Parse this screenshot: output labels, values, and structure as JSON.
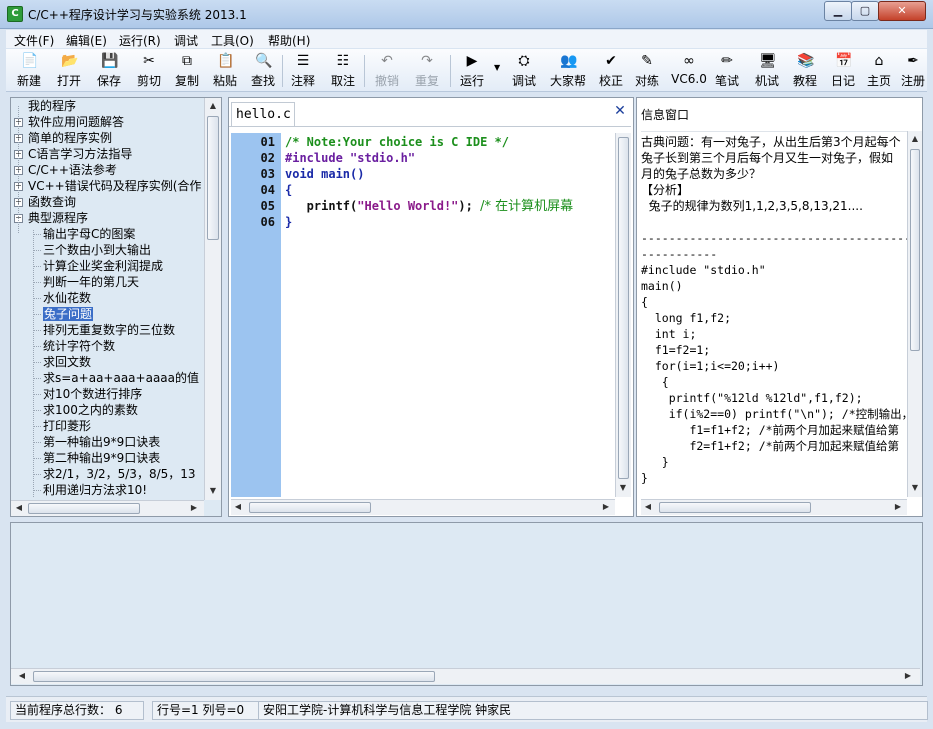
{
  "window": {
    "title": "C/C++程序设计学习与实验系统 2013.1",
    "icon_label": "C"
  },
  "menu": [
    "文件(F)",
    "编辑(E)",
    "运行(R)",
    "调试",
    "工具(O)",
    "帮助(H)"
  ],
  "toolbar": [
    {
      "label": "新建",
      "icon": "new-file-icon",
      "glyph": "📄"
    },
    {
      "label": "打开",
      "icon": "open-folder-icon",
      "glyph": "📂"
    },
    {
      "label": "保存",
      "icon": "save-icon",
      "glyph": "💾"
    },
    {
      "label": "剪切",
      "icon": "cut-icon",
      "glyph": "✂"
    },
    {
      "label": "复制",
      "icon": "copy-icon",
      "glyph": "⧉"
    },
    {
      "label": "粘贴",
      "icon": "paste-icon",
      "glyph": "📋"
    },
    {
      "label": "查找",
      "icon": "find-icon",
      "glyph": "🔍"
    },
    {
      "label": "注释",
      "icon": "comment-icon",
      "glyph": "☰"
    },
    {
      "label": "取注",
      "icon": "uncomment-icon",
      "glyph": "☷"
    },
    {
      "label": "撤销",
      "icon": "undo-icon",
      "glyph": "↶",
      "disabled": true
    },
    {
      "label": "重复",
      "icon": "redo-icon",
      "glyph": "↷",
      "disabled": true
    },
    {
      "label": "运行",
      "icon": "run-icon",
      "glyph": "▶"
    },
    {
      "label": "调试",
      "icon": "debug-icon",
      "glyph": "⛭"
    },
    {
      "label": "大家帮",
      "icon": "people-icon",
      "glyph": "👥"
    },
    {
      "label": "校正",
      "icon": "check-icon",
      "glyph": "✔"
    },
    {
      "label": "对练",
      "icon": "practice-icon",
      "glyph": "✎"
    },
    {
      "label": "VC6.0",
      "icon": "vc6-icon",
      "glyph": "∞"
    },
    {
      "label": "笔试",
      "icon": "pen-icon",
      "glyph": "✏"
    },
    {
      "label": "机试",
      "icon": "computer-icon",
      "glyph": "🖥"
    },
    {
      "label": "教程",
      "icon": "books-icon",
      "glyph": "📚"
    },
    {
      "label": "日记",
      "icon": "diary-icon",
      "glyph": "📅"
    },
    {
      "label": "主页",
      "icon": "home-icon",
      "glyph": "⌂"
    },
    {
      "label": "注册",
      "icon": "register-icon",
      "glyph": "✒"
    }
  ],
  "tree": {
    "root": "我的程序",
    "top_items": [
      "软件应用问题解答",
      "简单的程序实例",
      "C语言学习方法指导",
      "C/C++语法参考",
      "VC++错误代码及程序实例(合作",
      "函数查询",
      "典型源程序"
    ],
    "children": [
      "输出字母C的图案",
      "三个数由小到大输出",
      "计算企业奖金利润提成",
      "判断一年的第几天",
      "水仙花数",
      "兔子问题",
      "排列无重复数字的三位数",
      "统计字符个数",
      "求回文数",
      "求s=a+aa+aaa+aaaa的值",
      "对10个数进行排序",
      "求100之内的素数",
      "打印菱形",
      "第一种输出9*9口诀表",
      "第二种输出9*9口诀表",
      "求2/1，3/2，5/3，8/5，13",
      "利用递归方法求10!"
    ],
    "selected": "兔子问题"
  },
  "editor": {
    "tab": "hello.c",
    "line_numbers": [
      "01",
      "02",
      "03",
      "04",
      "05",
      "06"
    ],
    "code": {
      "l1": "/* Note:Your choice is C IDE */",
      "l2": "#include \"stdio.h\"",
      "l3": "void main()",
      "l4": "{",
      "l5a": "   printf(",
      "l5b": "\"Hello World!\"",
      "l5c": "); ",
      "l5d": "/* 在计算机屏幕",
      "l6": "}"
    }
  },
  "info": {
    "title": "信息窗口",
    "lines": [
      "古典问题：有一对兔子，从出生后第3个月起每个",
      "兔子长到第三个月后每个月又生一对兔子，假如",
      "月的兔子总数为多少？",
      "【分析】",
      "  兔子的规律为数列1,1,2,3,5,8,13,21....",
      "",
      "------------------------------------------",
      "-----------",
      "#include \"stdio.h\"",
      "main()",
      "{",
      "  long f1,f2;",
      "  int i;",
      "  f1=f2=1;",
      "  for(i=1;i<=20;i++)",
      "   {",
      "    printf(\"%12ld %12ld\",f1,f2);",
      "    if(i%2==0) printf(\"\\n\"); /*控制输出，",
      "       f1=f1+f2; /*前两个月加起来赋值给第",
      "       f2=f1+f2; /*前两个月加起来赋值给第",
      "   }",
      "}"
    ]
  },
  "status": {
    "total_lines": "当前程序总行数： 6",
    "row_col": "行号=1  列号=0",
    "school": "安阳工学院-计算机科学与信息工程学院  钟家民"
  }
}
